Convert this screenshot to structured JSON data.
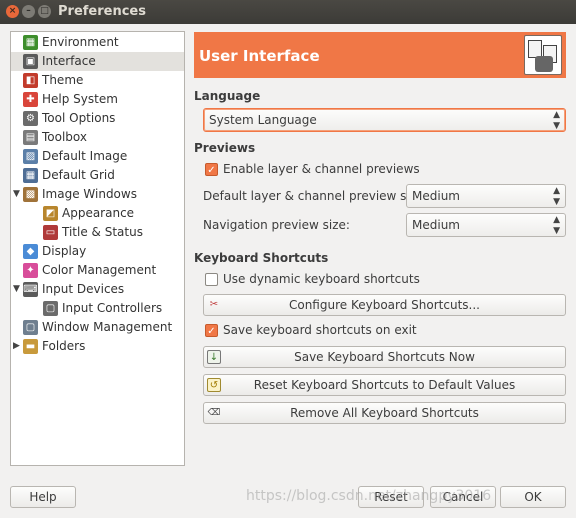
{
  "window": {
    "title": "Preferences"
  },
  "tree": {
    "items": [
      {
        "label": "Environment",
        "icon": "environment-icon",
        "color": "#3e8e2c",
        "glyph": "▦"
      },
      {
        "label": "Interface",
        "icon": "interface-icon",
        "color": "#5a5a5a",
        "glyph": "▣",
        "selected": true
      },
      {
        "label": "Theme",
        "icon": "theme-icon",
        "color": "#c23b2b",
        "glyph": "◧"
      },
      {
        "label": "Help System",
        "icon": "help-lifebuoy-icon",
        "color": "#d9453a",
        "glyph": "✚"
      },
      {
        "label": "Tool Options",
        "icon": "tool-options-icon",
        "color": "#6b6b6b",
        "glyph": "⚙"
      },
      {
        "label": "Toolbox",
        "icon": "toolbox-icon",
        "color": "#7a7a7a",
        "glyph": "▤"
      },
      {
        "label": "Default Image",
        "icon": "default-image-icon",
        "color": "#5b7fa8",
        "glyph": "▨"
      },
      {
        "label": "Default Grid",
        "icon": "default-grid-icon",
        "color": "#4f6e96",
        "glyph": "▦"
      },
      {
        "label": "Image Windows",
        "icon": "image-windows-icon",
        "color": "#a0733a",
        "glyph": "▩",
        "expander": "▼"
      },
      {
        "label": "Appearance",
        "icon": "appearance-icon",
        "color": "#b8862d",
        "glyph": "◩",
        "child": true
      },
      {
        "label": "Title & Status",
        "icon": "title-status-icon",
        "color": "#b03a3a",
        "glyph": "▭",
        "child": true
      },
      {
        "label": "Display",
        "icon": "display-icon",
        "color": "#4a8bd6",
        "glyph": "◆"
      },
      {
        "label": "Color Management",
        "icon": "color-management-icon",
        "color": "#d84d9a",
        "glyph": "✦"
      },
      {
        "label": "Input Devices",
        "icon": "input-devices-icon",
        "color": "#5b5b5b",
        "glyph": "⌨",
        "expander": "▼"
      },
      {
        "label": "Input Controllers",
        "icon": "input-controllers-icon",
        "color": "#6b6b6b",
        "glyph": "▢",
        "child": true
      },
      {
        "label": "Window Management",
        "icon": "window-management-icon",
        "color": "#6f7f8f",
        "glyph": "▢"
      },
      {
        "label": "Folders",
        "icon": "folders-icon",
        "color": "#c89a3c",
        "glyph": "▬",
        "expander": "▶"
      }
    ]
  },
  "header": {
    "title": "User Interface",
    "icon": "interface-preferences-icon"
  },
  "language": {
    "section_title": "Language",
    "selected": "System Language"
  },
  "previews": {
    "section_title": "Previews",
    "enable_label": "Enable layer & channel previews",
    "enable_checked": true,
    "layer_size_label": "Default layer & channel preview size:",
    "layer_size_value": "Medium",
    "nav_size_label": "Navigation preview size:",
    "nav_size_value": "Medium"
  },
  "shortcuts": {
    "section_title": "Keyboard Shortcuts",
    "dynamic_label": "Use dynamic keyboard shortcuts",
    "dynamic_checked": false,
    "configure_button": "Configure Keyboard Shortcuts...",
    "save_on_exit_label": "Save keyboard shortcuts on exit",
    "save_on_exit_checked": true,
    "save_now_button": "Save Keyboard Shortcuts Now",
    "reset_button": "Reset Keyboard Shortcuts to Default Values",
    "remove_all_button": "Remove All Keyboard Shortcuts"
  },
  "footer": {
    "help": "Help",
    "reset": "Reset",
    "cancel": "Cancel",
    "ok": "OK"
  },
  "watermark": "https://blog.csdn.net/zhangpy3016",
  "colors": {
    "accent": "#f07746",
    "titlebar": "#3c3b37"
  }
}
